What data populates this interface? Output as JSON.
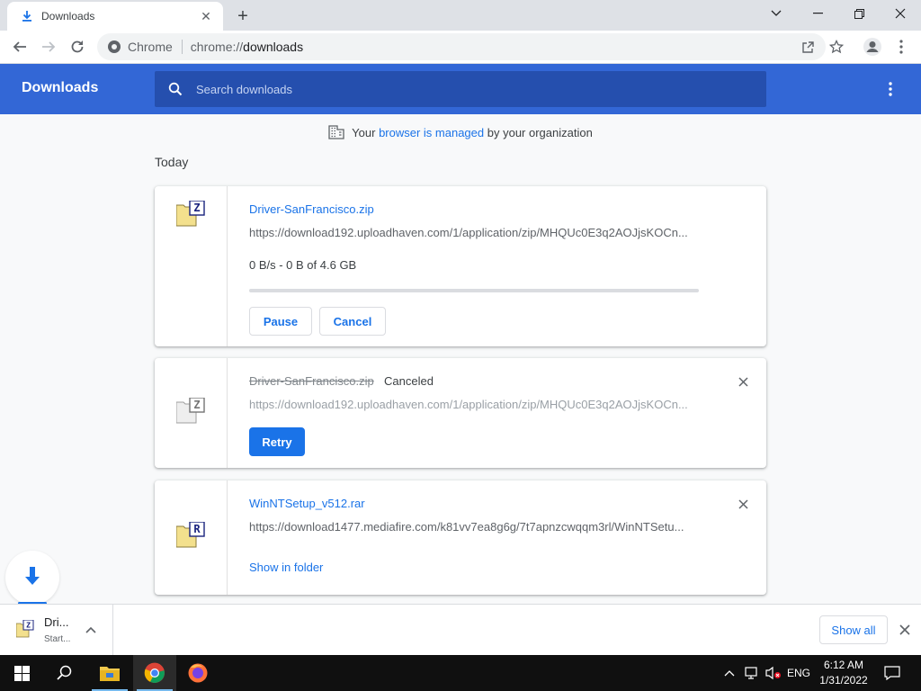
{
  "window": {
    "tab_title": "Downloads",
    "tab_close": "✕",
    "new_tab": "+"
  },
  "toolbar": {
    "site_label": "Chrome",
    "url_scheme": "chrome://",
    "url_host": "downloads"
  },
  "header": {
    "title": "Downloads",
    "search_placeholder": "Search downloads"
  },
  "managed_notice": {
    "prefix": "Your",
    "link": "browser is managed",
    "suffix": "by your organization"
  },
  "section_label": "Today",
  "downloads": [
    {
      "file_name": "Driver-SanFrancisco.zip",
      "file_type_letter": "Z",
      "url": "https://download192.uploadhaven.com/1/application/zip/MHQUc0E3q2AOJjsKOCn...",
      "progress_text": "0 B/s - 0 B of 4.6 GB",
      "progress_fraction": 0,
      "pause_label": "Pause",
      "cancel_label": "Cancel"
    },
    {
      "file_name": "Driver-SanFrancisco.zip",
      "file_type_letter": "Z",
      "status": "Canceled",
      "url": "https://download192.uploadhaven.com/1/application/zip/MHQUc0E3q2AOJjsKOCn...",
      "retry_label": "Retry"
    },
    {
      "file_name": "WinNTSetup_v512.rar",
      "file_type_letter": "R",
      "url": "https://download1477.mediafire.com/k81vv7ea8g6g/7t7apnzcwqqm3rl/WinNTSetu...",
      "show_in_folder_label": "Show in folder"
    }
  ],
  "shelf": {
    "item_name": "Dri...",
    "item_status": "Start...",
    "show_all_label": "Show all"
  },
  "taskbar": {
    "language": "ENG",
    "time": "6:12 AM",
    "date": "1/31/2022"
  },
  "colors": {
    "accent": "#1a73e8",
    "header_bg": "#3367d6",
    "search_bg": "#254fae"
  }
}
